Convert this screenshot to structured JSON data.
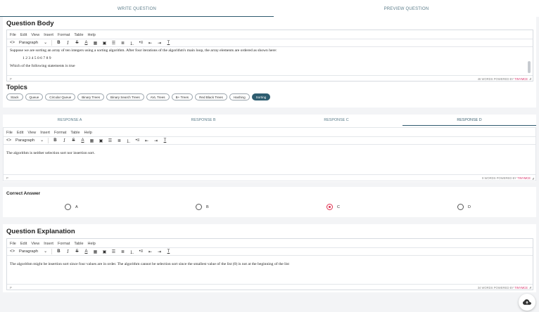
{
  "tabs": {
    "write": "WRITE QUESTION",
    "preview": "PREVIEW QUESTION"
  },
  "menu": [
    "File",
    "Edit",
    "View",
    "Insert",
    "Format",
    "Table",
    "Help"
  ],
  "toolbar": {
    "code": "<>",
    "paragraph": "Paragraph",
    "bold": "B",
    "italic": "I",
    "strike": "S",
    "text_color": "A",
    "clear": "T"
  },
  "question_body": {
    "title": "Question Body",
    "line1": "Suppose we are sorting an array of ten integers using a sorting algorithm. After four iterations of the algorithm's main loop, the array elements are ordered as shown here:",
    "line2": "1 2 3 4 5 0 6 7 8 9",
    "line3": "Which of the following statements is true",
    "status_left": "P",
    "words": "46 WORDS POWERED BY",
    "tiny": "TINYMCE"
  },
  "topics": {
    "title": "Topics",
    "items": [
      "Stack",
      "Queue",
      "Circular Queue",
      "Binary Trees",
      "Binary Search Trees",
      "AVL Trees",
      "B+ Trees",
      "Red Black Trees",
      "Hashing",
      "Sorting"
    ],
    "selected": "Sorting"
  },
  "responses": {
    "tabs": [
      "RESPONSE A",
      "RESPONSE B",
      "RESPONSE C",
      "RESPONSE D"
    ],
    "active": "RESPONSE D",
    "content": "The algorithm is neither selection sort nor insertion sort.",
    "status_left": "P",
    "words": "9 WORDS POWERED BY",
    "tiny": "TINYMCE"
  },
  "correct_answer": {
    "title": "Correct Answer",
    "options": [
      "A",
      "B",
      "C",
      "D"
    ],
    "selected": "C"
  },
  "explanation": {
    "title": "Question Explanation",
    "content": "The algorithm might be insertion sort since four values are in order. The algorithm cannot be selection sort since the smallest value of the list (0) is not at the beginning of the list",
    "status_left": "P",
    "words": "34 WORDS POWERED BY",
    "tiny": "TINYMCE"
  },
  "fab_icon": "cloud-upload-icon"
}
